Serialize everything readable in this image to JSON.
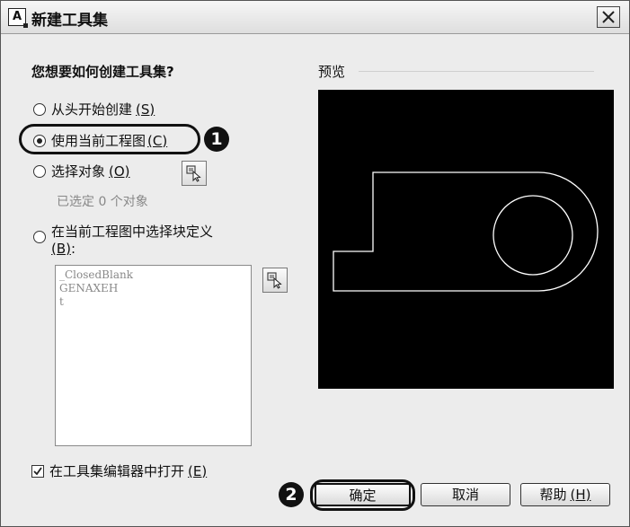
{
  "window": {
    "app_icon_letter": "A",
    "title": "新建工具集"
  },
  "question": "您想要如何创建工具集?",
  "options": {
    "scratch": {
      "label": "从头开始创建",
      "shortcut": "(S)"
    },
    "current": {
      "label": "使用当前工程图",
      "shortcut": "(C)"
    },
    "objects": {
      "label": "选择对象",
      "shortcut": "(O)"
    },
    "selected_info": "已选定 0 个对象",
    "block": {
      "label": "在当前工程图中选择块定义",
      "shortcut": "(B)",
      "suffix": ":"
    }
  },
  "block_list": [
    "_ClosedBlank",
    "GENAXEH",
    "t"
  ],
  "open_in_editor": {
    "label": "在工具集编辑器中打开",
    "shortcut": "(E)",
    "checked": true
  },
  "preview": {
    "label": "预览"
  },
  "buttons": {
    "ok": "确定",
    "cancel": "取消",
    "help": "帮助",
    "help_shortcut": "(H)"
  },
  "markers": {
    "one": "1",
    "two": "2"
  },
  "colors": {
    "preview_bg": "#000000",
    "preview_stroke": "#ffffff"
  }
}
